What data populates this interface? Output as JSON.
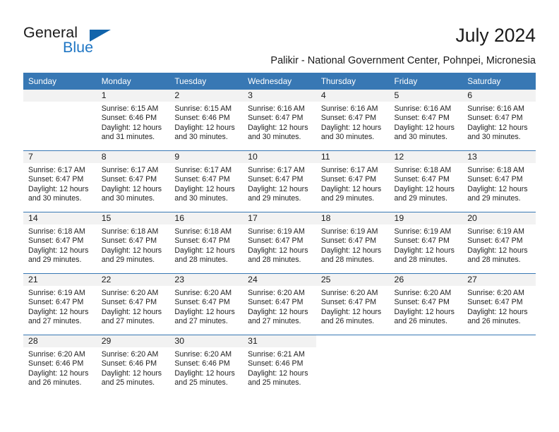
{
  "brand": {
    "name_top": "General",
    "name_bottom": "Blue",
    "accent_color": "#1f76c4",
    "triangle_color": "#1164ab"
  },
  "header": {
    "title": "July 2024",
    "subtitle": "Palikir - National Government Center, Pohnpei, Micronesia"
  },
  "theme": {
    "header_row_bg": "#3878b4",
    "daynum_band_bg": "#f2f2f2",
    "text_color": "#222222"
  },
  "columns": [
    "Sunday",
    "Monday",
    "Tuesday",
    "Wednesday",
    "Thursday",
    "Friday",
    "Saturday"
  ],
  "weeks": [
    [
      {
        "day": "",
        "sunrise": "",
        "sunset": "",
        "daylight_line1": "",
        "daylight_line2": "",
        "filled": false,
        "blank_band": false
      },
      {
        "day": "1",
        "sunrise": "Sunrise: 6:15 AM",
        "sunset": "Sunset: 6:46 PM",
        "daylight_line1": "Daylight: 12 hours",
        "daylight_line2": "and 31 minutes.",
        "filled": true,
        "blank_band": false
      },
      {
        "day": "2",
        "sunrise": "Sunrise: 6:15 AM",
        "sunset": "Sunset: 6:46 PM",
        "daylight_line1": "Daylight: 12 hours",
        "daylight_line2": "and 30 minutes.",
        "filled": true,
        "blank_band": false
      },
      {
        "day": "3",
        "sunrise": "Sunrise: 6:16 AM",
        "sunset": "Sunset: 6:47 PM",
        "daylight_line1": "Daylight: 12 hours",
        "daylight_line2": "and 30 minutes.",
        "filled": true,
        "blank_band": false
      },
      {
        "day": "4",
        "sunrise": "Sunrise: 6:16 AM",
        "sunset": "Sunset: 6:47 PM",
        "daylight_line1": "Daylight: 12 hours",
        "daylight_line2": "and 30 minutes.",
        "filled": true,
        "blank_band": false
      },
      {
        "day": "5",
        "sunrise": "Sunrise: 6:16 AM",
        "sunset": "Sunset: 6:47 PM",
        "daylight_line1": "Daylight: 12 hours",
        "daylight_line2": "and 30 minutes.",
        "filled": true,
        "blank_band": false
      },
      {
        "day": "6",
        "sunrise": "Sunrise: 6:16 AM",
        "sunset": "Sunset: 6:47 PM",
        "daylight_line1": "Daylight: 12 hours",
        "daylight_line2": "and 30 minutes.",
        "filled": true,
        "blank_band": false
      }
    ],
    [
      {
        "day": "7",
        "sunrise": "Sunrise: 6:17 AM",
        "sunset": "Sunset: 6:47 PM",
        "daylight_line1": "Daylight: 12 hours",
        "daylight_line2": "and 30 minutes.",
        "filled": true,
        "blank_band": false
      },
      {
        "day": "8",
        "sunrise": "Sunrise: 6:17 AM",
        "sunset": "Sunset: 6:47 PM",
        "daylight_line1": "Daylight: 12 hours",
        "daylight_line2": "and 30 minutes.",
        "filled": true,
        "blank_band": false
      },
      {
        "day": "9",
        "sunrise": "Sunrise: 6:17 AM",
        "sunset": "Sunset: 6:47 PM",
        "daylight_line1": "Daylight: 12 hours",
        "daylight_line2": "and 30 minutes.",
        "filled": true,
        "blank_band": false
      },
      {
        "day": "10",
        "sunrise": "Sunrise: 6:17 AM",
        "sunset": "Sunset: 6:47 PM",
        "daylight_line1": "Daylight: 12 hours",
        "daylight_line2": "and 29 minutes.",
        "filled": true,
        "blank_band": false
      },
      {
        "day": "11",
        "sunrise": "Sunrise: 6:17 AM",
        "sunset": "Sunset: 6:47 PM",
        "daylight_line1": "Daylight: 12 hours",
        "daylight_line2": "and 29 minutes.",
        "filled": true,
        "blank_band": false
      },
      {
        "day": "12",
        "sunrise": "Sunrise: 6:18 AM",
        "sunset": "Sunset: 6:47 PM",
        "daylight_line1": "Daylight: 12 hours",
        "daylight_line2": "and 29 minutes.",
        "filled": true,
        "blank_band": false
      },
      {
        "day": "13",
        "sunrise": "Sunrise: 6:18 AM",
        "sunset": "Sunset: 6:47 PM",
        "daylight_line1": "Daylight: 12 hours",
        "daylight_line2": "and 29 minutes.",
        "filled": true,
        "blank_band": false
      }
    ],
    [
      {
        "day": "14",
        "sunrise": "Sunrise: 6:18 AM",
        "sunset": "Sunset: 6:47 PM",
        "daylight_line1": "Daylight: 12 hours",
        "daylight_line2": "and 29 minutes.",
        "filled": true,
        "blank_band": false
      },
      {
        "day": "15",
        "sunrise": "Sunrise: 6:18 AM",
        "sunset": "Sunset: 6:47 PM",
        "daylight_line1": "Daylight: 12 hours",
        "daylight_line2": "and 29 minutes.",
        "filled": true,
        "blank_band": false
      },
      {
        "day": "16",
        "sunrise": "Sunrise: 6:18 AM",
        "sunset": "Sunset: 6:47 PM",
        "daylight_line1": "Daylight: 12 hours",
        "daylight_line2": "and 28 minutes.",
        "filled": true,
        "blank_band": false
      },
      {
        "day": "17",
        "sunrise": "Sunrise: 6:19 AM",
        "sunset": "Sunset: 6:47 PM",
        "daylight_line1": "Daylight: 12 hours",
        "daylight_line2": "and 28 minutes.",
        "filled": true,
        "blank_band": false
      },
      {
        "day": "18",
        "sunrise": "Sunrise: 6:19 AM",
        "sunset": "Sunset: 6:47 PM",
        "daylight_line1": "Daylight: 12 hours",
        "daylight_line2": "and 28 minutes.",
        "filled": true,
        "blank_band": false
      },
      {
        "day": "19",
        "sunrise": "Sunrise: 6:19 AM",
        "sunset": "Sunset: 6:47 PM",
        "daylight_line1": "Daylight: 12 hours",
        "daylight_line2": "and 28 minutes.",
        "filled": true,
        "blank_band": false
      },
      {
        "day": "20",
        "sunrise": "Sunrise: 6:19 AM",
        "sunset": "Sunset: 6:47 PM",
        "daylight_line1": "Daylight: 12 hours",
        "daylight_line2": "and 28 minutes.",
        "filled": true,
        "blank_band": false
      }
    ],
    [
      {
        "day": "21",
        "sunrise": "Sunrise: 6:19 AM",
        "sunset": "Sunset: 6:47 PM",
        "daylight_line1": "Daylight: 12 hours",
        "daylight_line2": "and 27 minutes.",
        "filled": true,
        "blank_band": false
      },
      {
        "day": "22",
        "sunrise": "Sunrise: 6:20 AM",
        "sunset": "Sunset: 6:47 PM",
        "daylight_line1": "Daylight: 12 hours",
        "daylight_line2": "and 27 minutes.",
        "filled": true,
        "blank_band": false
      },
      {
        "day": "23",
        "sunrise": "Sunrise: 6:20 AM",
        "sunset": "Sunset: 6:47 PM",
        "daylight_line1": "Daylight: 12 hours",
        "daylight_line2": "and 27 minutes.",
        "filled": true,
        "blank_band": false
      },
      {
        "day": "24",
        "sunrise": "Sunrise: 6:20 AM",
        "sunset": "Sunset: 6:47 PM",
        "daylight_line1": "Daylight: 12 hours",
        "daylight_line2": "and 27 minutes.",
        "filled": true,
        "blank_band": false
      },
      {
        "day": "25",
        "sunrise": "Sunrise: 6:20 AM",
        "sunset": "Sunset: 6:47 PM",
        "daylight_line1": "Daylight: 12 hours",
        "daylight_line2": "and 26 minutes.",
        "filled": true,
        "blank_band": false
      },
      {
        "day": "26",
        "sunrise": "Sunrise: 6:20 AM",
        "sunset": "Sunset: 6:47 PM",
        "daylight_line1": "Daylight: 12 hours",
        "daylight_line2": "and 26 minutes.",
        "filled": true,
        "blank_band": false
      },
      {
        "day": "27",
        "sunrise": "Sunrise: 6:20 AM",
        "sunset": "Sunset: 6:47 PM",
        "daylight_line1": "Daylight: 12 hours",
        "daylight_line2": "and 26 minutes.",
        "filled": true,
        "blank_band": false
      }
    ],
    [
      {
        "day": "28",
        "sunrise": "Sunrise: 6:20 AM",
        "sunset": "Sunset: 6:46 PM",
        "daylight_line1": "Daylight: 12 hours",
        "daylight_line2": "and 26 minutes.",
        "filled": true,
        "blank_band": false
      },
      {
        "day": "29",
        "sunrise": "Sunrise: 6:20 AM",
        "sunset": "Sunset: 6:46 PM",
        "daylight_line1": "Daylight: 12 hours",
        "daylight_line2": "and 25 minutes.",
        "filled": true,
        "blank_band": false
      },
      {
        "day": "30",
        "sunrise": "Sunrise: 6:20 AM",
        "sunset": "Sunset: 6:46 PM",
        "daylight_line1": "Daylight: 12 hours",
        "daylight_line2": "and 25 minutes.",
        "filled": true,
        "blank_band": false
      },
      {
        "day": "31",
        "sunrise": "Sunrise: 6:21 AM",
        "sunset": "Sunset: 6:46 PM",
        "daylight_line1": "Daylight: 12 hours",
        "daylight_line2": "and 25 minutes.",
        "filled": true,
        "blank_band": false
      },
      {
        "day": "",
        "sunrise": "",
        "sunset": "",
        "daylight_line1": "",
        "daylight_line2": "",
        "filled": false,
        "blank_band": true
      },
      {
        "day": "",
        "sunrise": "",
        "sunset": "",
        "daylight_line1": "",
        "daylight_line2": "",
        "filled": false,
        "blank_band": true
      },
      {
        "day": "",
        "sunrise": "",
        "sunset": "",
        "daylight_line1": "",
        "daylight_line2": "",
        "filled": false,
        "blank_band": true
      }
    ]
  ]
}
